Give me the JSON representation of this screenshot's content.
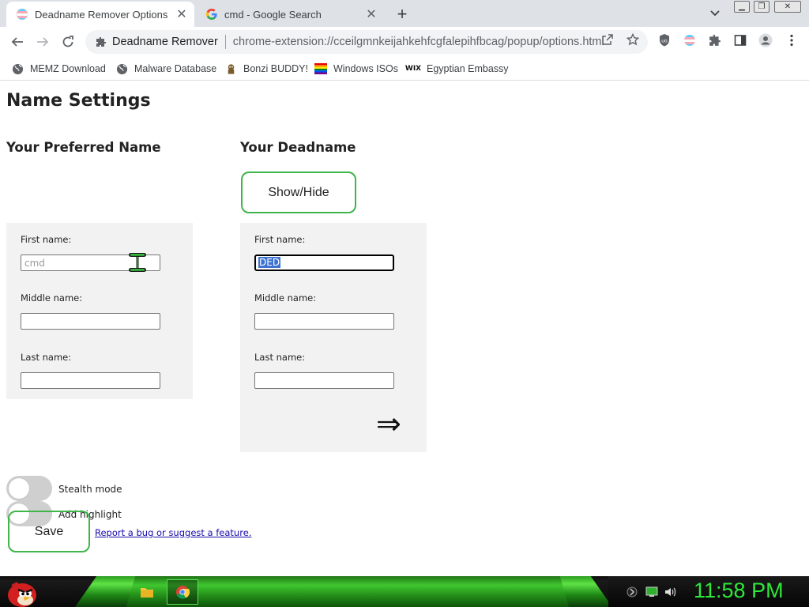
{
  "browser": {
    "tabs": [
      {
        "label": "Deadname Remover Options",
        "active": true,
        "favicon": "trans-flag-icon"
      },
      {
        "label": "cmd - Google Search",
        "active": false,
        "favicon": "google-g-icon"
      }
    ],
    "omnibox": {
      "site_label": "Deadname Remover",
      "url": "chrome-extension://cceilgmnkeijahkehfcgfalepihfbcag/popup/options.html"
    },
    "bookmarks": [
      {
        "label": "MEMZ Download",
        "icon": "globe-icon"
      },
      {
        "label": "Malware Database",
        "icon": "globe-icon"
      },
      {
        "label": "Bonzi BUDDY!",
        "icon": "bonzi-icon"
      },
      {
        "label": "Windows ISOs",
        "icon": "rainbow-flag-icon"
      },
      {
        "label": "Egyptian Embassy",
        "icon": "wix-icon"
      }
    ]
  },
  "page": {
    "title": "Name Settings",
    "preferred": {
      "heading": "Your Preferred Name",
      "first_label": "First name:",
      "first_placeholder": "cmd",
      "middle_label": "Middle name:",
      "last_label": "Last name:"
    },
    "deadname": {
      "heading": "Your Deadname",
      "show_hide_label": "Show/Hide",
      "first_label": "First name:",
      "first_value": "DED",
      "middle_label": "Middle name:",
      "last_label": "Last name:",
      "arrow": "⇒"
    },
    "stealth_label": "Stealth mode",
    "highlight_label": "Add highlight",
    "save_label": "Save",
    "report_link": "Report a bug or suggest a feature."
  },
  "taskbar": {
    "clock": "11:58 PM"
  },
  "colors": {
    "accent_green": "#3fb54a",
    "selection_blue": "#3f73d1",
    "clock_green": "#2fe83a"
  }
}
